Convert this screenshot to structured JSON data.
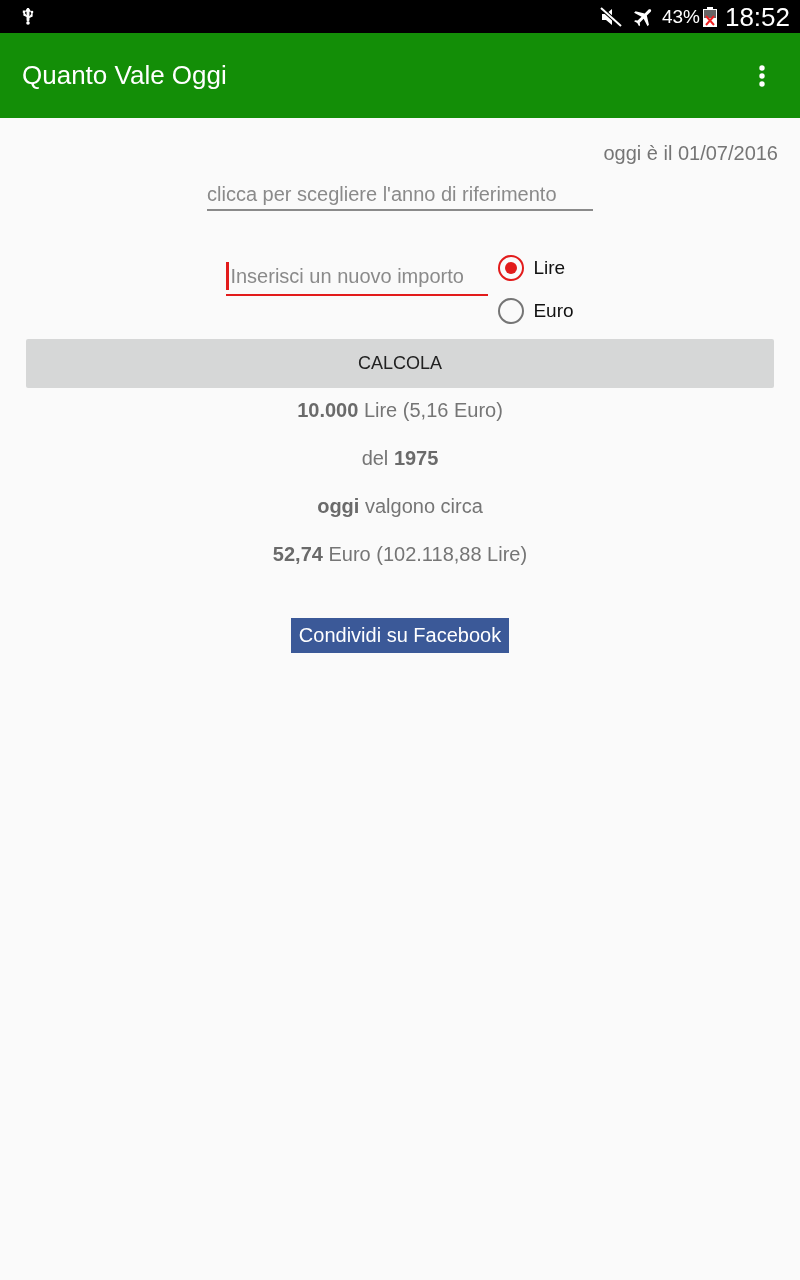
{
  "status_bar": {
    "battery": "43%",
    "time": "18:52"
  },
  "app_bar": {
    "title": "Quanto Vale Oggi"
  },
  "today": "oggi è il 01/07/2016",
  "year_field": {
    "placeholder": "clicca per scegliere l'anno di riferimento"
  },
  "amount_field": {
    "placeholder": "Inserisci un nuovo importo",
    "focused": true
  },
  "currency": [
    {
      "label": "Lire",
      "selected": true
    },
    {
      "label": "Euro",
      "selected": false
    }
  ],
  "calculate_button": "CALCOLA",
  "results": [
    "**10.000** Lire (5,16 Euro)",
    "del **1975**",
    "**oggi** valgono circa",
    "**52,74** Euro (102.118,88 Lire)"
  ],
  "share_button": "Condividi su Facebook"
}
